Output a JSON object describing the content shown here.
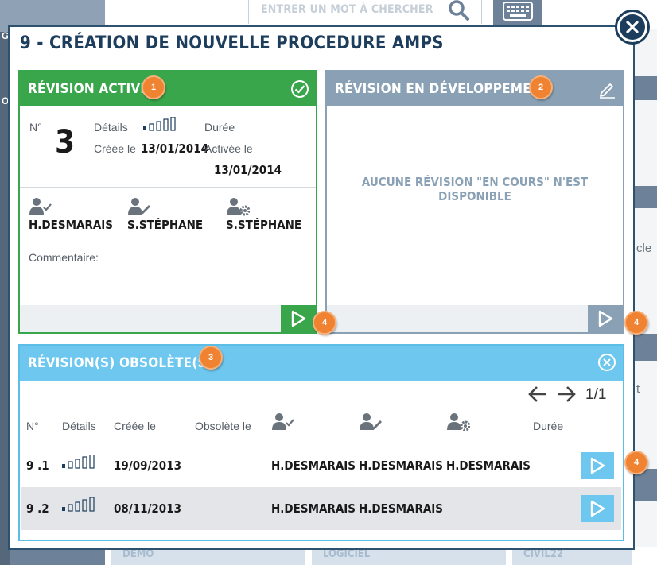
{
  "background": {
    "search_placeholder": "ENTRER UN MOT À CHERCHER",
    "right_fragments": [
      "cle",
      "t"
    ],
    "bottom_buttons": [
      "DEMO",
      "LOGICIEL",
      "CIVIL22"
    ],
    "side_fragments": [
      "G",
      "O"
    ]
  },
  "modal": {
    "title": "9 - CRÉATION DE NOUVELLE PROCEDURE AMPS",
    "active": {
      "header": "RÉVISION ACTIVE",
      "badge": "1",
      "num_label": "N°",
      "number": "3",
      "details_label": "Détails",
      "duree_label": "Durée",
      "created_label": "Créée le",
      "created_value": "13/01/2014",
      "activated_label": "Activée le",
      "activated_value": "13/01/2014",
      "users": [
        "H.DESMARAIS",
        "S.STÉPHANE",
        "S.STÉPHANE"
      ],
      "comment_label": "Commentaire:",
      "play_badge": "4"
    },
    "development": {
      "header": "RÉVISION EN DÉVELOPPEMENT",
      "badge": "2",
      "empty_message": "AUCUNE RÉVISION \"EN COURS\" N'EST DISPONIBLE",
      "play_badge": "4"
    },
    "obsolete": {
      "header": "RÉVISION(S) OBSOLÈTE(S)",
      "badge": "3",
      "pager": "1/1",
      "columns": {
        "num": "N°",
        "details": "Détails",
        "created": "Créée le",
        "obsolete": "Obsolète le",
        "duree": "Durée"
      },
      "rows": [
        {
          "num": "9 .1",
          "created": "19/09/2013",
          "obsolete": "",
          "approver": "H.DESMARAIS",
          "author": "H.DESMARAIS",
          "manager": "H.DESMARAIS"
        },
        {
          "num": "9 .2",
          "created": "08/11/2013",
          "obsolete": "",
          "approver": "H.DESMARAIS",
          "author": "H.DESMARAIS",
          "manager": ""
        }
      ],
      "play_badge": "4"
    }
  },
  "colors": {
    "active_green": "#3aa64c",
    "dev_grey": "#8aa1b5",
    "obsolete_blue": "#6dc7ee",
    "title_navy": "#1d3d5c",
    "badge_orange": "#ef8331"
  }
}
